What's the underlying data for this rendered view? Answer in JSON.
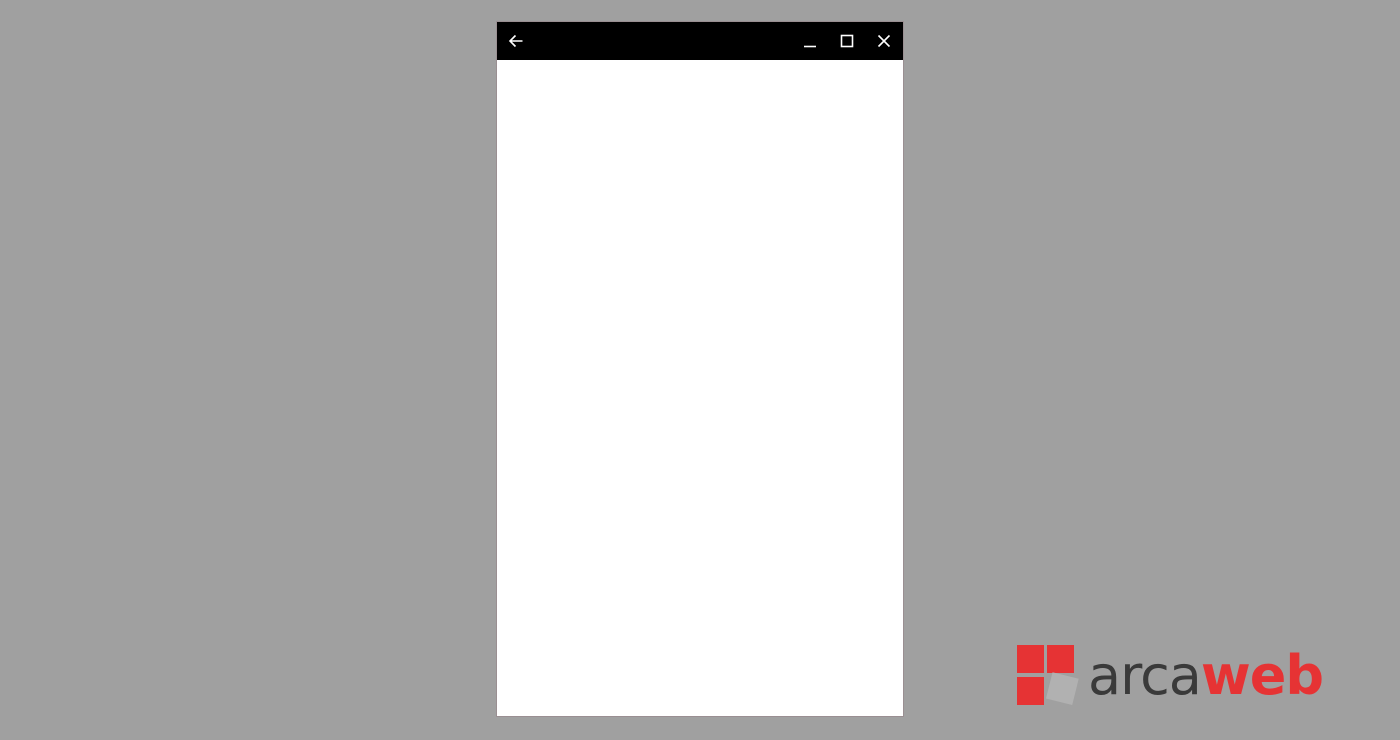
{
  "window": {
    "titlebar": {
      "back_icon": "arrow-left-icon",
      "minimize_icon": "minimize-icon",
      "maximize_icon": "maximize-icon",
      "close_icon": "close-icon"
    },
    "content_background": "#ffffff"
  },
  "watermark": {
    "text_part1": "arca",
    "text_part2": "web",
    "colors": {
      "primary_red": "#e63334",
      "text_dark": "#3a3a3a",
      "mark_gray": "#b3b3b3"
    }
  },
  "colors": {
    "desktop_background": "#a0a0a0",
    "titlebar_background": "#000000",
    "titlebar_icons": "#ffffff"
  }
}
